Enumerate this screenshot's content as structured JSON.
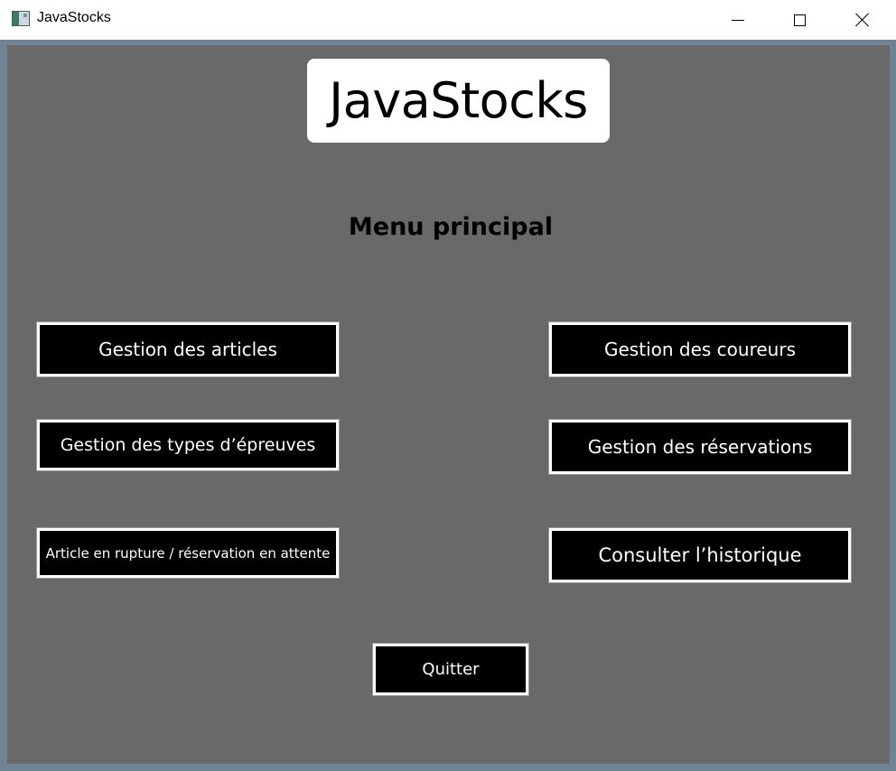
{
  "window": {
    "title": "JavaStocks",
    "icon": "app-window-icon",
    "controls": [
      "minimize-icon",
      "maximize-icon",
      "close-icon"
    ]
  },
  "logo": {
    "text": "JavaStocks"
  },
  "menu": {
    "title": "Menu principal",
    "buttons": {
      "articles": "Gestion des articles",
      "coureurs": "Gestion des coureurs",
      "types_epreuves": "Gestion des types d’épreuves",
      "reservations": "Gestion des réservations",
      "rupture": "Article en rupture / réservation en attente",
      "historique": "Consulter l’historique",
      "quitter": "Quitter"
    }
  },
  "colors": {
    "background": "#696969",
    "button_bg": "#000000",
    "button_border": "#ffffff",
    "logo_bg": "#ffffff"
  }
}
